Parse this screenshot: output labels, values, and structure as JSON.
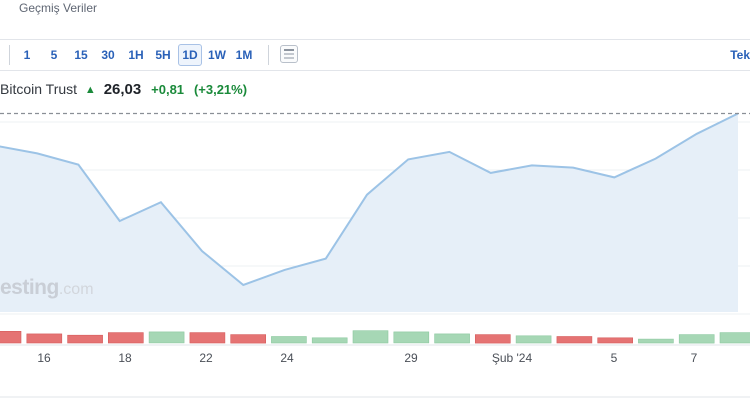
{
  "top_link": "Geçmiş Veriler",
  "toolbar": {
    "intervals": [
      "1",
      "5",
      "15",
      "30",
      "1H",
      "5H",
      "1D",
      "1W",
      "1M"
    ],
    "active_interval": "1D",
    "right_label": "Tek"
  },
  "quote": {
    "name": "Bitcoin Trust",
    "price": "26,03",
    "change": "+0,81",
    "change_pct": "(+3,21%)",
    "direction": "up",
    "positive_color": "#1a8a3a"
  },
  "watermark": {
    "text": "esting",
    "suffix": ".com"
  },
  "chart_data": {
    "type": "area",
    "x": [
      "",
      "16",
      "",
      "18",
      "",
      "22",
      "",
      "24",
      "",
      "",
      "29",
      "",
      "Şub '24",
      "",
      "5",
      "",
      "7",
      ""
    ],
    "values": [
      25.6,
      25.5,
      25.35,
      24.6,
      24.85,
      24.2,
      23.75,
      23.95,
      24.1,
      24.95,
      25.42,
      25.52,
      25.24,
      25.34,
      25.31,
      25.18,
      25.43,
      25.76,
      26.03
    ],
    "last_price_line": 26.03,
    "volume": [
      {
        "v": 0.9,
        "dir": "down"
      },
      {
        "v": 0.7,
        "dir": "down"
      },
      {
        "v": 0.6,
        "dir": "down"
      },
      {
        "v": 0.8,
        "dir": "down"
      },
      {
        "v": 0.85,
        "dir": "up"
      },
      {
        "v": 0.8,
        "dir": "down"
      },
      {
        "v": 0.65,
        "dir": "down"
      },
      {
        "v": 0.5,
        "dir": "up"
      },
      {
        "v": 0.4,
        "dir": "up"
      },
      {
        "v": 0.95,
        "dir": "up"
      },
      {
        "v": 0.85,
        "dir": "up"
      },
      {
        "v": 0.7,
        "dir": "up"
      },
      {
        "v": 0.65,
        "dir": "down"
      },
      {
        "v": 0.55,
        "dir": "up"
      },
      {
        "v": 0.5,
        "dir": "down"
      },
      {
        "v": 0.4,
        "dir": "down"
      },
      {
        "v": 0.3,
        "dir": "up"
      },
      {
        "v": 0.65,
        "dir": "up"
      },
      {
        "v": 0.8,
        "dir": "up"
      }
    ],
    "colors": {
      "line": "#9cc3e6",
      "fill": "#e6eff8",
      "up": "#a6d7b5",
      "down": "#e57373",
      "ref_line": "#8a8f96"
    }
  }
}
